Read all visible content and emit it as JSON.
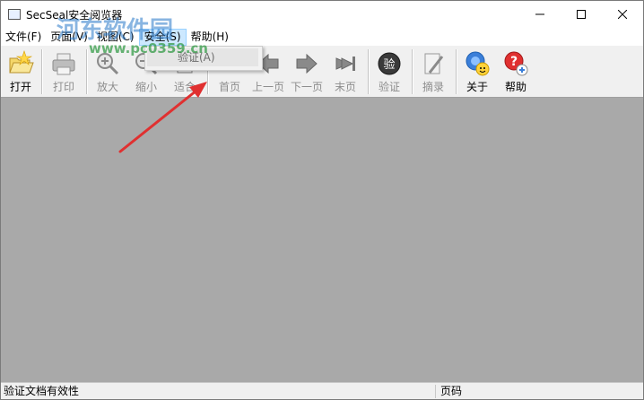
{
  "window": {
    "title": "SecSeal安全阅览器"
  },
  "menu": {
    "items": [
      {
        "label": "文件(F)"
      },
      {
        "label": "页面(V)"
      },
      {
        "label": "视图(C)"
      },
      {
        "label": "安全(S)"
      },
      {
        "label": "帮助(H)"
      }
    ],
    "dropdown": {
      "item": "验证(A)"
    }
  },
  "toolbar": {
    "open": "打开",
    "print": "打印",
    "zoom_in": "放大",
    "zoom_out": "缩小",
    "fit": "适合",
    "first": "首页",
    "prev": "上一页",
    "next": "下一页",
    "last": "末页",
    "verify": "验证",
    "extract": "摘录",
    "about": "关于",
    "help": "帮助"
  },
  "status": {
    "left": "验证文档有效性",
    "right": "页码"
  },
  "watermark": {
    "text": "河东软件园",
    "url": "www.pc0359.cn"
  },
  "colors": {
    "main_bg": "#a9a9a9",
    "arrow": "#e03030",
    "menu_highlight": "#cce8ff"
  }
}
